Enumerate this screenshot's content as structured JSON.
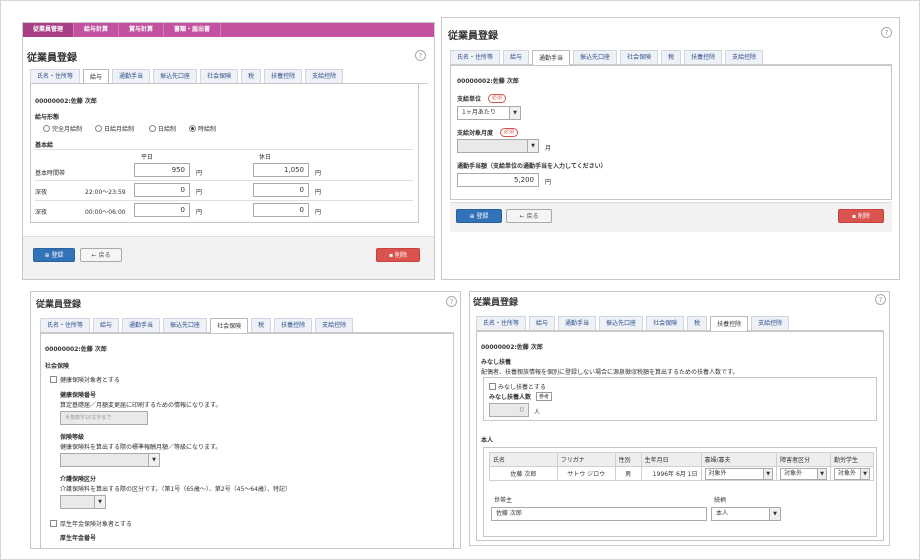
{
  "p1": {
    "nav": [
      "従業員管理",
      "給与計算",
      "賞与計算",
      "書類・届出書"
    ],
    "title": "従業員登録",
    "tabs": [
      "氏名・住所等",
      "給与",
      "通勤手当",
      "振込先口座",
      "社会保険",
      "税",
      "扶養控除",
      "支給控除"
    ],
    "employee": "00000002:佐藤 次郎",
    "pay_type_label": "給与形態",
    "pay_types": [
      "完全月給制",
      "日給月給制",
      "日給制",
      "時給制"
    ],
    "base_label": "基本給",
    "col_weekday": "平日",
    "col_holiday": "休日",
    "rows": [
      {
        "label": "基本時間帯",
        "time": "",
        "weekday": "950",
        "holiday": "1,050"
      },
      {
        "label": "深夜",
        "time": "22:00〜23:59",
        "weekday": "0",
        "holiday": "0"
      },
      {
        "label": "深夜",
        "time": "00:00〜06:00",
        "weekday": "0",
        "holiday": "0"
      }
    ],
    "unit": "円",
    "register": "登録",
    "back": "戻る",
    "delete": "削除"
  },
  "p2": {
    "title": "従業員登録",
    "tabs": [
      "氏名・住所等",
      "給与",
      "通勤手当",
      "振込先口座",
      "社会保険",
      "税",
      "扶養控除",
      "支給控除"
    ],
    "employee": "00000002:佐藤 次郎",
    "unit_label": "支給単位",
    "required": "必須",
    "unit_value": "1ヶ月あたり",
    "month_label": "支給対象月度",
    "month_unit": "月",
    "amount_label": "通勤手当額（支給単位の通勤手当を入力してください）",
    "amount": "5,200",
    "yen": "円",
    "register": "登録",
    "back": "戻る",
    "delete": "削除"
  },
  "p3": {
    "title": "従業員登録",
    "tabs": [
      "氏名・住所等",
      "給与",
      "通勤手当",
      "振込先口座",
      "社会保険",
      "税",
      "扶養控除",
      "支給控除"
    ],
    "employee": "00000002:佐藤 次郎",
    "section": "社会保険",
    "health_chk": "健康保険対象者とする",
    "health_no_label": "健康保険番号",
    "health_no_desc": "算定基礎届／月額変更届に印刷するための情報になります。",
    "health_no_ph": "半角数字10文字まで",
    "grade_label": "保険等級",
    "grade_desc": "健康保険料を算出する際の標準報酬月額／等級になります。",
    "care_label": "介護保険区分",
    "care_desc": "介護保険料を算出する際の区分です。（第1号（65歳〜）、第2号（45〜64歳）、特記）",
    "pension_chk": "厚生年金保険対象者とする",
    "pension_no_label": "厚生年金番号"
  },
  "p4": {
    "title": "従業員登録",
    "tabs": [
      "氏名・住所等",
      "給与",
      "通勤手当",
      "振込先口座",
      "社会保険",
      "税",
      "扶養控除",
      "支給控除"
    ],
    "employee": "00000002:佐藤 次郎",
    "deemed_label": "みなし扶養",
    "deemed_desc": "配偶者、扶養親族情報を個別に登録しない場合に源泉徴収税額を算出するための扶養人数です。",
    "deemed_chk": "みなし扶養とする",
    "deemed_count_label": "みなし扶養人数",
    "ref": "参考",
    "deemed_count": "0",
    "person": "人",
    "self_label": "本人",
    "headers": [
      "氏名",
      "フリガナ",
      "性別",
      "生年月日",
      "寡婦/寡夫",
      "障害者区分",
      "勤労学生"
    ],
    "row": {
      "name": "佐藤 次郎",
      "kana": "サトウ ジロウ",
      "sex": "男",
      "birth": "1996年 6月 1日",
      "widow": "対象外",
      "disabled": "対象外",
      "student": "対象外"
    },
    "householder_label": "世帯主",
    "relation_label": "続柄",
    "householder": "佐藤 次郎",
    "relation": "本人"
  }
}
